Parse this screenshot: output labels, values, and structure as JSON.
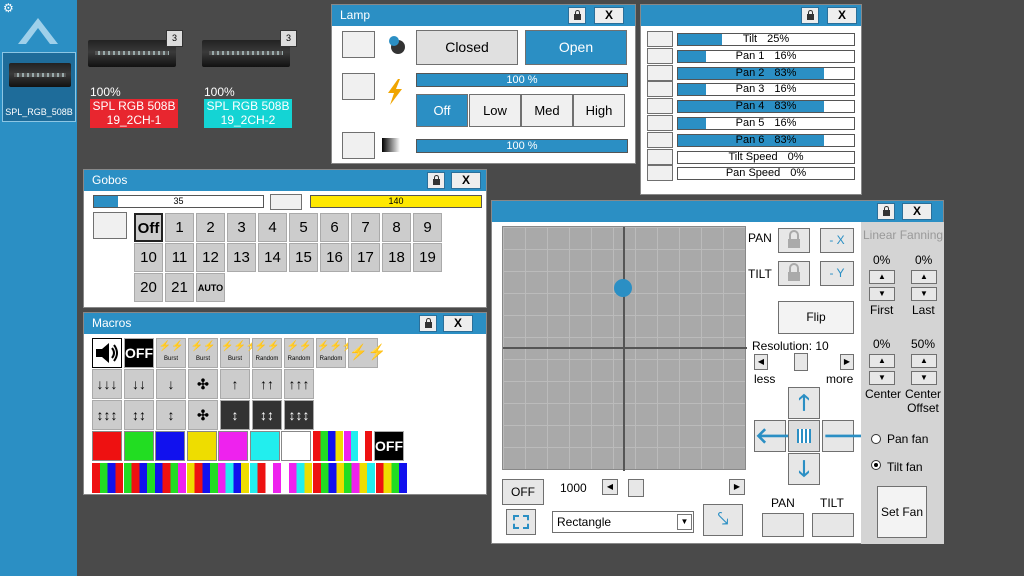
{
  "sidebar": {
    "fixture_label": "SPL_RGB_508B"
  },
  "fixtures": [
    {
      "num": "3",
      "pct": "100%",
      "name": "SPL RGB 508B 19_2CH-1",
      "color": "#e8262f"
    },
    {
      "num": "3",
      "pct": "100%",
      "name": "SPL RGB 508B 19_2CH-2",
      "color": "#14d4d4"
    }
  ],
  "lamp": {
    "title": "Lamp",
    "closed": "Closed",
    "open": "Open",
    "bar1": "100 %",
    "bar2": "100 %",
    "off": "Off",
    "low": "Low",
    "med": "Med",
    "high": "High",
    "close": "X"
  },
  "sliders": {
    "close": "X",
    "items": [
      {
        "label": "Tilt",
        "value": "25%",
        "level": 0.25
      },
      {
        "label": "Pan 1",
        "value": "16%",
        "level": 0.16
      },
      {
        "label": "Pan 2",
        "value": "83%",
        "level": 0.83
      },
      {
        "label": "Pan 3",
        "value": "16%",
        "level": 0.16
      },
      {
        "label": "Pan 4",
        "value": "83%",
        "level": 0.83
      },
      {
        "label": "Pan 5",
        "value": "16%",
        "level": 0.16
      },
      {
        "label": "Pan 6",
        "value": "83%",
        "level": 0.83
      },
      {
        "label": "Tilt Speed",
        "value": "0%",
        "level": 0
      },
      {
        "label": "Pan Speed",
        "value": "0%",
        "level": 0
      }
    ]
  },
  "gobos": {
    "title": "Gobos",
    "close": "X",
    "bar1": "35",
    "bar2": "140",
    "off": "Off",
    "row1": [
      "1",
      "2",
      "3",
      "4",
      "5",
      "6",
      "7",
      "8",
      "9"
    ],
    "row2": [
      "10",
      "11",
      "12",
      "13",
      "14",
      "15",
      "16",
      "17",
      "18",
      "19"
    ],
    "row3": [
      "20",
      "21",
      "AUTO"
    ]
  },
  "macros": {
    "title": "Macros",
    "close": "X",
    "off1": "OFF",
    "off2": "OFF",
    "burst": "Burst",
    "random": "Random",
    "colors": [
      "#ee1111",
      "#22dd22",
      "#1111ee",
      "#eedd00",
      "#ee22ee",
      "#22eeee",
      "#ffffff"
    ]
  },
  "pantilt": {
    "close": "X",
    "pan": "PAN",
    "tilt": "TILT",
    "minus_x": "- X",
    "minus_y": "- Y",
    "flip": "Flip",
    "resolution": "Resolution: 10",
    "less": "less",
    "more": "more",
    "off": "OFF",
    "value": "1000",
    "shape": "Rectangle",
    "pan_bottom": "PAN",
    "tilt_bottom": "TILT"
  },
  "fanning": {
    "title": "Linear Fanning",
    "first_val": "0%",
    "last_val": "0%",
    "first": "First",
    "last": "Last",
    "center_val": "0%",
    "offset_val": "50%",
    "center": "Center",
    "center_offset": "Center Offset",
    "pan_fan": "Pan fan",
    "tilt_fan": "Tilt fan",
    "set_fan": "Set Fan"
  }
}
